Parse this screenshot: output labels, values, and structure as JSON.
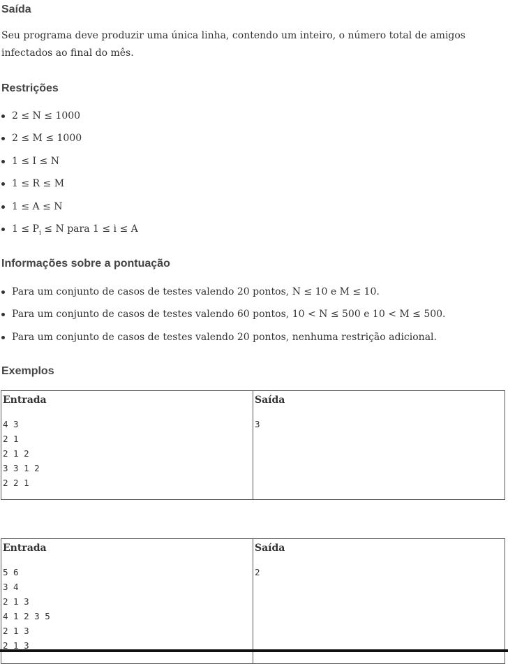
{
  "saida": {
    "heading": "Saída",
    "text": "Seu programa deve produzir uma única linha, contendo um inteiro, o número total de amigos infectados ao final do mês."
  },
  "restricoes": {
    "heading": "Restrições",
    "items": [
      "2 ≤ N ≤ 1000",
      "2 ≤ M ≤ 1000",
      "1 ≤ I ≤ N",
      "1 ≤ R ≤ M",
      "1 ≤ A ≤ N"
    ],
    "last_prefix": "1 ≤ P",
    "last_sub": "i",
    "last_suffix": " ≤ N para 1 ≤ i ≤ A"
  },
  "pontuacao": {
    "heading": "Informações sobre a pontuação",
    "items": [
      "Para um conjunto de casos de testes valendo 20 pontos, N ≤ 10 e M ≤ 10.",
      "Para um conjunto de casos de testes valendo 60 pontos, 10 < N ≤ 500 e 10 < M ≤ 500.",
      "Para um conjunto de casos de testes valendo 20 pontos, nenhuma restrição adicional."
    ]
  },
  "exemplos": {
    "heading": "Exemplos",
    "col_entrada": "Entrada",
    "col_saida": "Saída",
    "examples": [
      {
        "entrada": "4 3\n2 1\n2 1 2\n3 3 1 2\n2 2 1",
        "saida": "3"
      },
      {
        "entrada": "5 6\n3 4\n2 1 3\n4 1 2 3 5\n2 1 3\n2 1 3",
        "saida": "2"
      }
    ]
  }
}
